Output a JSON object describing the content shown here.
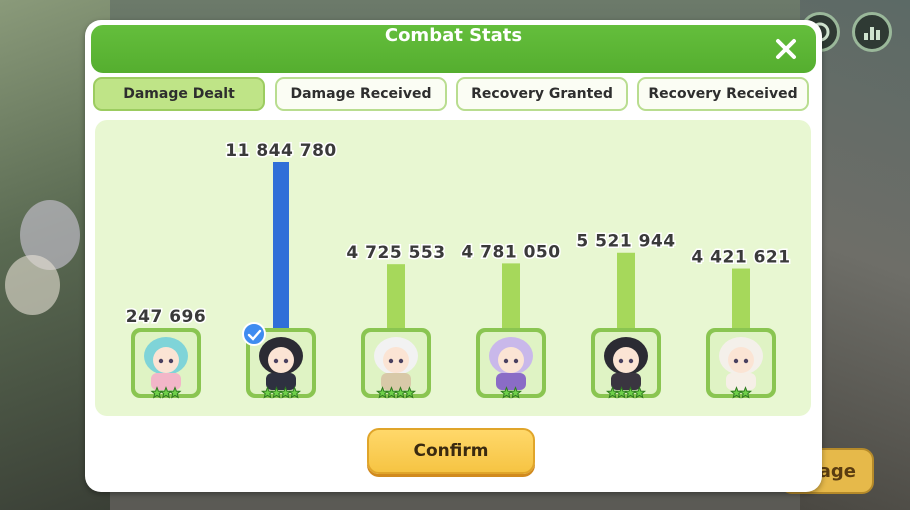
{
  "dialog": {
    "title": "Combat Stats",
    "close_icon": "close-icon",
    "confirm_label": "Confirm"
  },
  "tabs": [
    {
      "label": "Damage Dealt",
      "active": true
    },
    {
      "label": "Damage Received",
      "active": false
    },
    {
      "label": "Recovery Granted",
      "active": false
    },
    {
      "label": "Recovery Received",
      "active": false
    }
  ],
  "background": {
    "button_partial_label": "age"
  },
  "colors": {
    "accent_green": "#5bb434",
    "bar_green": "#a6d85b",
    "bar_highlight": "#2f6fd8",
    "confirm_yellow": "#f8c94a"
  },
  "chart_data": {
    "type": "bar",
    "values": [
      247696,
      11844780,
      4725553,
      4781050,
      5521944,
      4421621
    ],
    "value_labels": [
      "247 696",
      "11 844 780",
      "4 725 553",
      "4 781 050",
      "5 521 944",
      "4 421 621"
    ],
    "highlighted_index": 1,
    "characters": [
      {
        "stars": 3,
        "hair": "#7fd4d8",
        "outfit": "#f2b6c8"
      },
      {
        "stars": 4,
        "hair": "#2b2b33",
        "outfit": "#2e3140",
        "badge": true
      },
      {
        "stars": 4,
        "hair": "#f2f2f2",
        "outfit": "#d8c9a8"
      },
      {
        "stars": 2,
        "hair": "#c9b8ea",
        "outfit": "#8a6cc6"
      },
      {
        "stars": 4,
        "hair": "#2b2b33",
        "outfit": "#3a3540"
      },
      {
        "stars": 2,
        "hair": "#f4f0ea",
        "outfit": "#f6efe7"
      }
    ]
  }
}
